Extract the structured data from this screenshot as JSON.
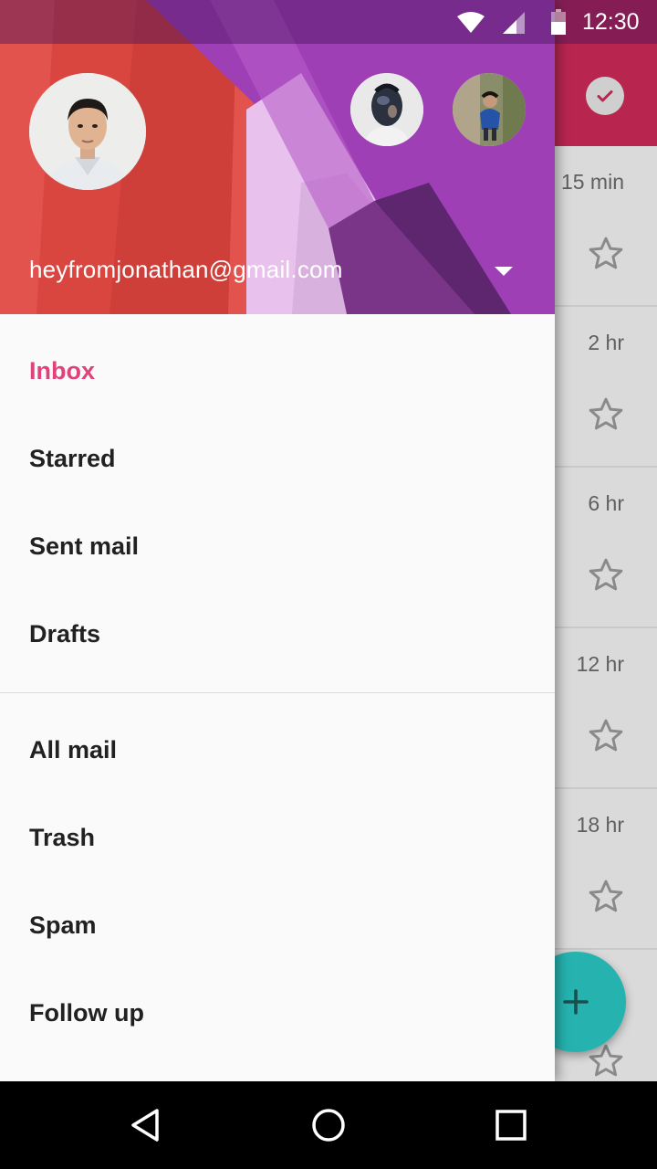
{
  "status_bar": {
    "time": "12:30"
  },
  "account": {
    "email": "heyfromjonathan@gmail.com"
  },
  "menu": {
    "primary": [
      {
        "label": "Inbox",
        "active": true
      },
      {
        "label": "Starred"
      },
      {
        "label": "Sent mail"
      },
      {
        "label": "Drafts"
      }
    ],
    "secondary": [
      {
        "label": "All mail"
      },
      {
        "label": "Trash"
      },
      {
        "label": "Spam"
      },
      {
        "label": "Follow up"
      }
    ]
  },
  "background_list": {
    "times": [
      "15 min",
      "2 hr",
      "6 hr",
      "12 hr",
      "18 hr",
      ""
    ]
  },
  "colors": {
    "accent": "#e0437a",
    "toolbar": "#b8264f",
    "fab": "#26b3b0"
  },
  "icons": {
    "fab": "add-icon",
    "toolbar_action": "check-circle-icon",
    "row_action": "star-outline-icon"
  }
}
